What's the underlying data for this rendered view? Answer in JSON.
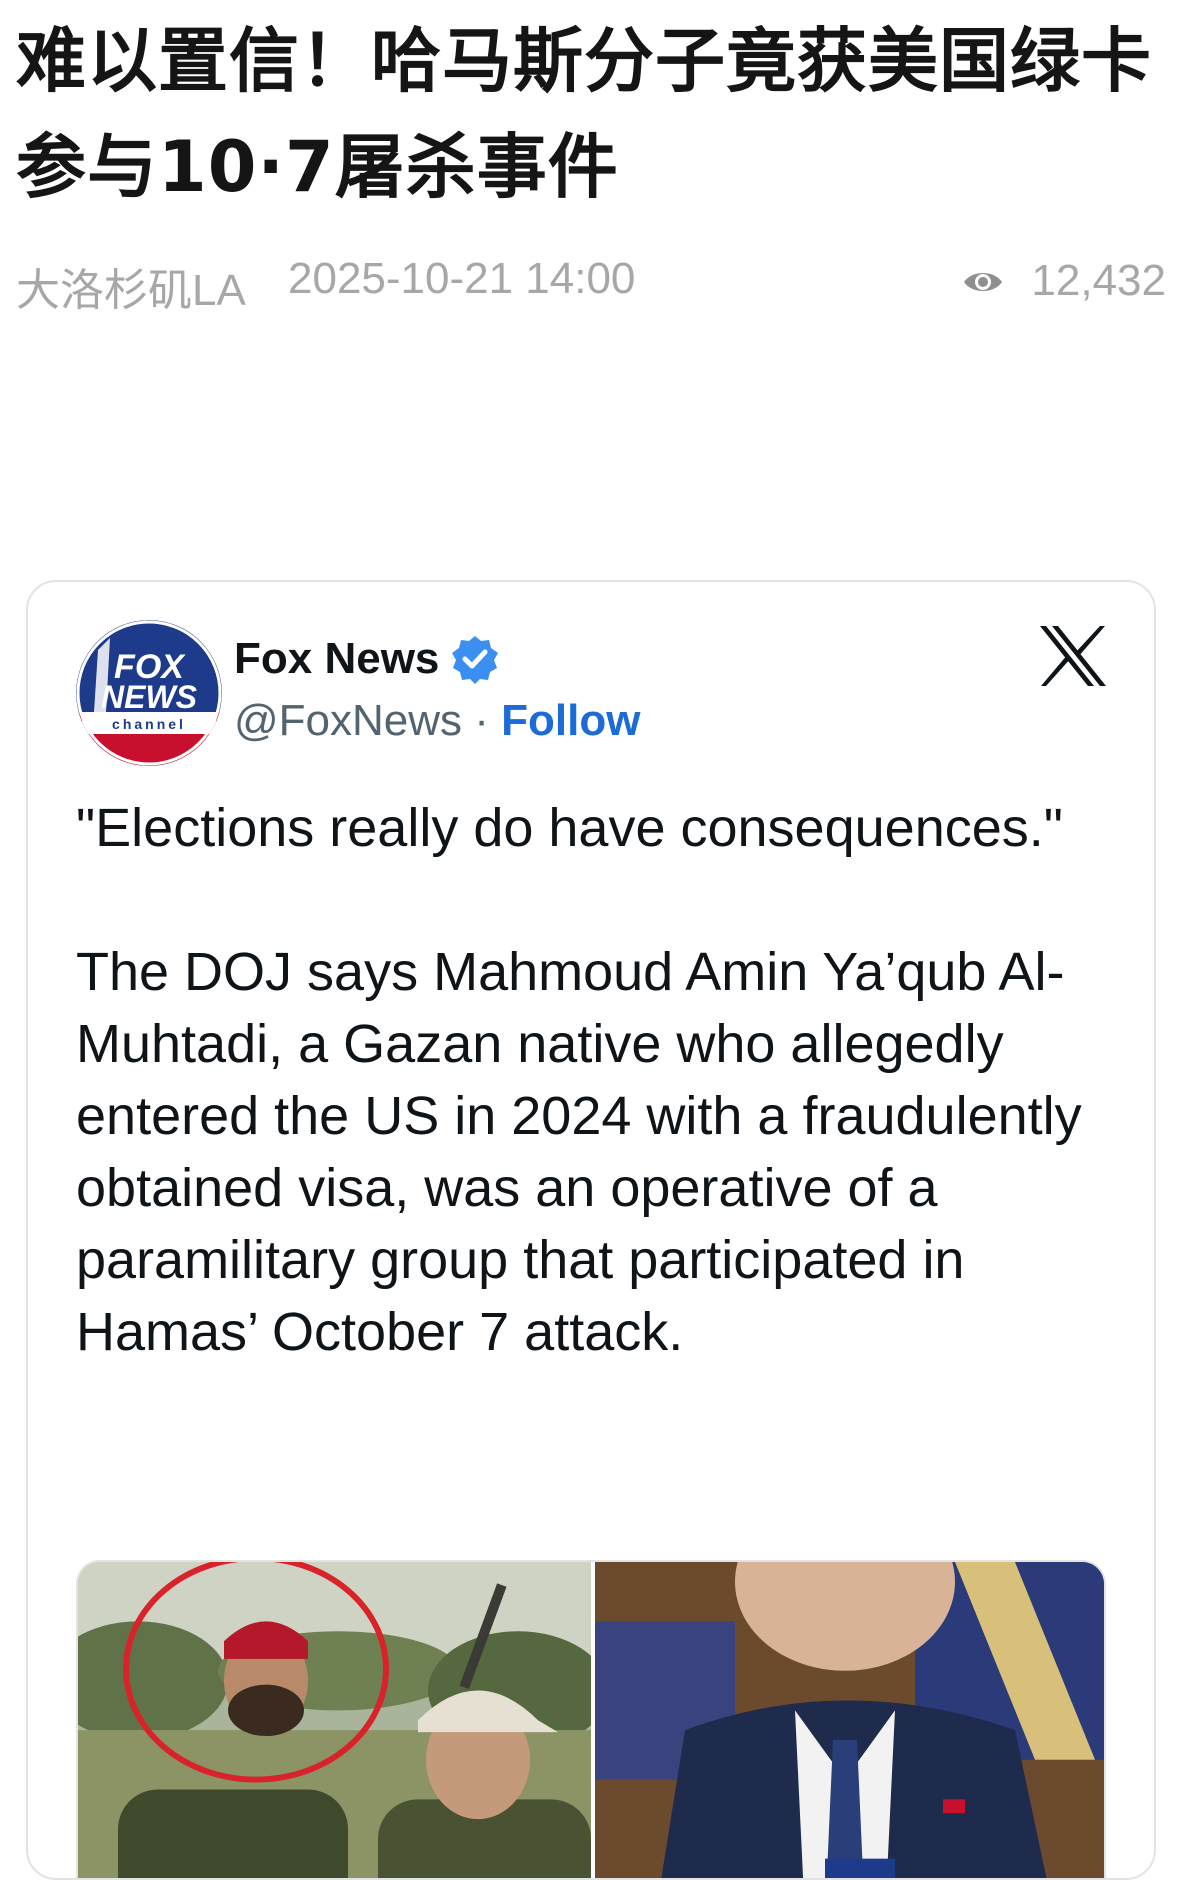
{
  "article": {
    "title": "难以置信！哈马斯分子竟获美国绿卡 参与10·7屠杀事件",
    "author": "大洛杉矶LA",
    "date": "2025-10-21 14:00",
    "views": "12,432"
  },
  "tweet": {
    "account_name": "Fox News",
    "handle": "@FoxNews",
    "separator": " · ",
    "follow_label": "Follow",
    "quote": "\"Elections really do have consequences.\"",
    "body": "The DOJ says Mahmoud Amin Ya’qub Al-Muhtadi, a Gazan native who allegedly entered the US in 2024 with a fraudulently obtained visa, was an operative of a paramilitary group that participated in Hamas’ October 7 attack."
  },
  "colors": {
    "follow": "#1d6bd6",
    "verified": "#3b8ff0",
    "fox_blue": "#1e3a8a",
    "fox_red": "#c8102e"
  },
  "icons": {
    "views": "eye-icon",
    "verified": "verified-badge-icon",
    "platform": "x-logo-icon"
  }
}
